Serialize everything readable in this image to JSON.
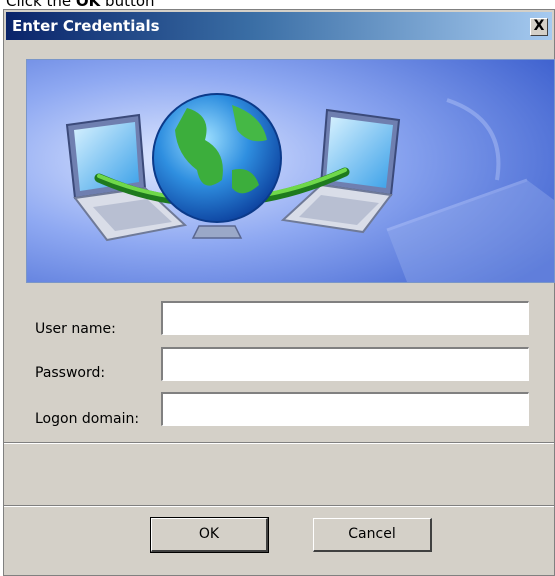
{
  "instruction": {
    "prefix": "Click the ",
    "target": "OK",
    "suffix": " button"
  },
  "dialog": {
    "title": "Enter Credentials",
    "close_label": "X"
  },
  "banner": {
    "description_icons": [
      "globe-icon",
      "laptop-icon",
      "laptop-icon",
      "keyboard-icon"
    ]
  },
  "form": {
    "username_label": "User name:",
    "username_value": "",
    "password_label": "Password:",
    "password_value": "",
    "domain_label": "Logon domain:",
    "domain_value": ""
  },
  "buttons": {
    "ok_label": "OK",
    "cancel_label": "Cancel"
  },
  "colors": {
    "dialog_bg": "#d4d0c8",
    "title_start": "#0a246a",
    "title_end": "#a6caf0"
  }
}
